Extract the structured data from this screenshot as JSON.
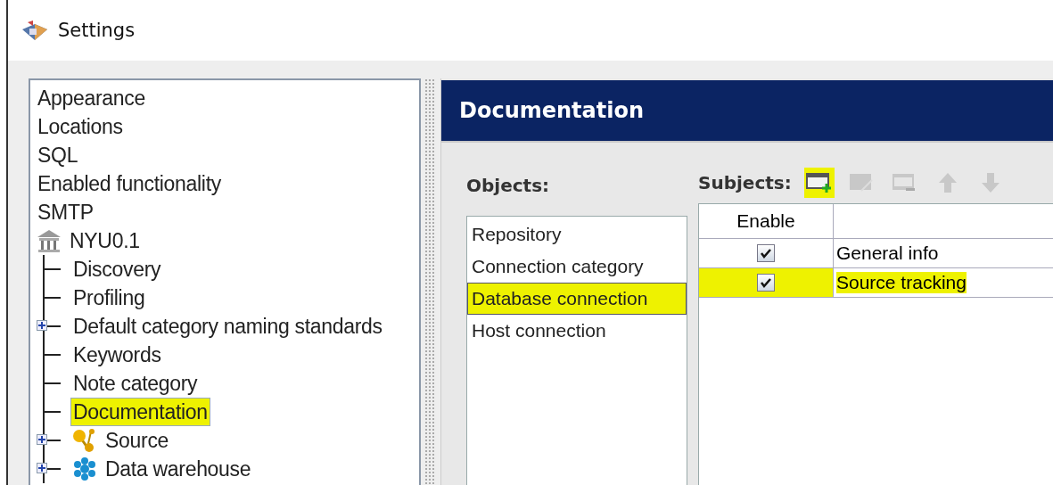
{
  "window": {
    "title": "Settings"
  },
  "sidebar": {
    "items": [
      {
        "label": "Appearance",
        "kind": "plain",
        "selected": false,
        "highlighted": false
      },
      {
        "label": "Locations",
        "kind": "plain",
        "selected": false,
        "highlighted": false
      },
      {
        "label": "SQL",
        "kind": "plain",
        "selected": false,
        "highlighted": false
      },
      {
        "label": "Enabled functionality",
        "kind": "plain",
        "selected": false,
        "highlighted": false
      },
      {
        "label": "SMTP",
        "kind": "plain",
        "selected": false,
        "highlighted": false
      },
      {
        "label": "NYU0.1",
        "kind": "repository",
        "selected": false,
        "highlighted": false,
        "children": [
          {
            "label": "Discovery",
            "kind": "plain",
            "selected": false,
            "highlighted": false
          },
          {
            "label": "Profiling",
            "kind": "plain",
            "selected": false,
            "highlighted": false
          },
          {
            "label": "Default category naming standards",
            "kind": "plain",
            "selected": false,
            "highlighted": false,
            "expanded": false
          },
          {
            "label": "Keywords",
            "kind": "plain",
            "selected": false,
            "highlighted": false
          },
          {
            "label": "Note category",
            "kind": "plain",
            "selected": false,
            "highlighted": false
          },
          {
            "label": "Documentation",
            "kind": "plain",
            "selected": true,
            "highlighted": true
          },
          {
            "label": "Source",
            "kind": "source",
            "selected": false,
            "highlighted": false,
            "expanded": false
          },
          {
            "label": "Data warehouse",
            "kind": "warehouse",
            "selected": false,
            "highlighted": false,
            "expanded": false
          }
        ]
      }
    ]
  },
  "panel": {
    "title": "Documentation",
    "objects": {
      "label": "Objects:",
      "items": [
        {
          "label": "Repository",
          "selected": false,
          "highlighted": false
        },
        {
          "label": "Connection category",
          "selected": false,
          "highlighted": false
        },
        {
          "label": "Database connection",
          "selected": true,
          "highlighted": true
        },
        {
          "label": "Host connection",
          "selected": false,
          "highlighted": false
        }
      ]
    },
    "subjects": {
      "label": "Subjects:",
      "toolbar": [
        {
          "kind": "add",
          "disabled": false,
          "highlighted": true
        },
        {
          "kind": "edit",
          "disabled": true,
          "highlighted": false
        },
        {
          "kind": "remove",
          "disabled": true,
          "highlighted": false
        },
        {
          "kind": "up",
          "disabled": true,
          "highlighted": false
        },
        {
          "kind": "down",
          "disabled": true,
          "highlighted": false
        }
      ],
      "table": {
        "columns": [
          "Enable"
        ],
        "rows": [
          {
            "enabled": true,
            "name": "General info",
            "highlighted": false
          },
          {
            "enabled": true,
            "name": "Source tracking",
            "highlighted": true
          }
        ]
      }
    }
  }
}
